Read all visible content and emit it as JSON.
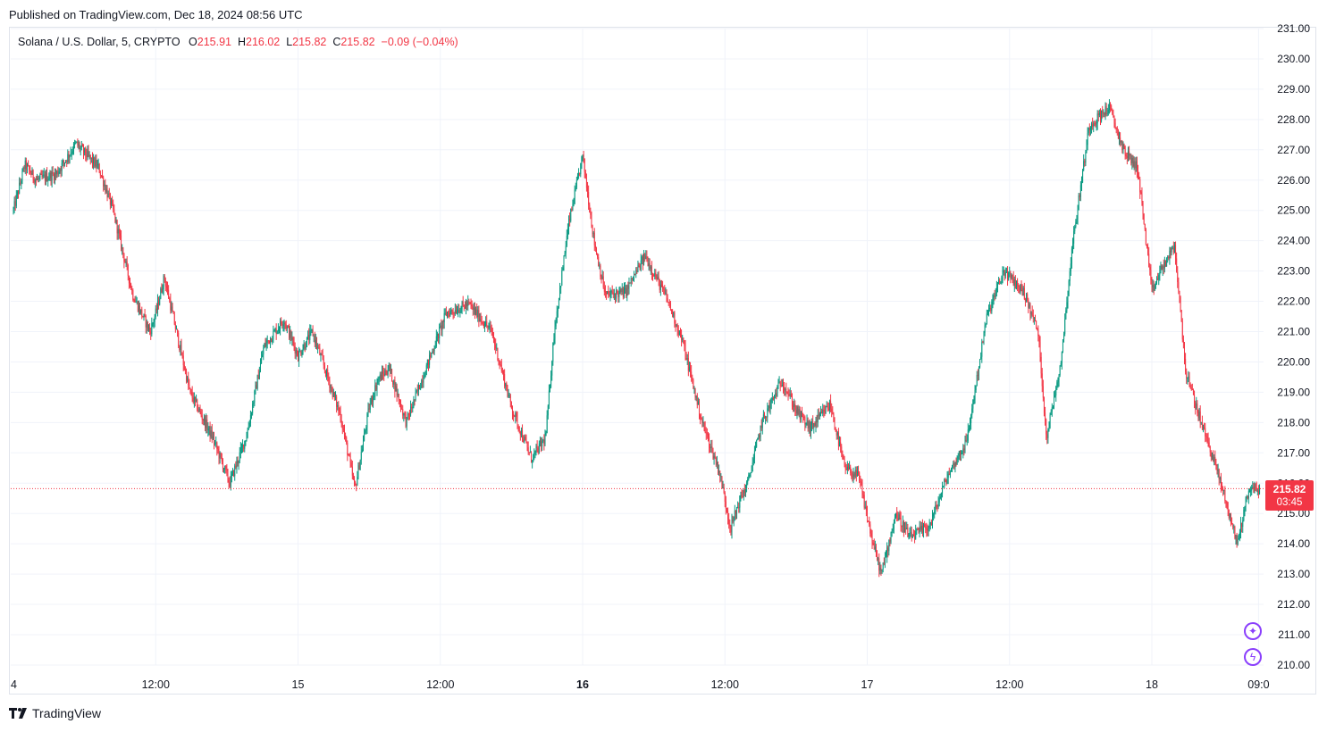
{
  "header": {
    "published": "Published on TradingView.com, Dec 18, 2024 08:56 UTC"
  },
  "legend": {
    "symbol": "Solana / U.S. Dollar, 5, CRYPTO",
    "o_label": "O",
    "o_value": "215.91",
    "h_label": "H",
    "h_value": "216.02",
    "l_label": "L",
    "l_value": "215.82",
    "c_label": "C",
    "c_value": "215.82",
    "change": "−0.09 (−0.04%)"
  },
  "price_tag": {
    "price": "215.82",
    "countdown": "03:45"
  },
  "footer": {
    "brand": "TradingView"
  },
  "colors": {
    "up": "#089981",
    "down": "#f23645",
    "wick": "#131722",
    "grid": "#f0f3fa",
    "current_line": "#f23645",
    "accent_purple": "#8a3ffc"
  },
  "icons": {
    "sparkle": "sparkle-icon",
    "lightning": "lightning-icon"
  },
  "chart_data": {
    "type": "candlestick",
    "symbol": "Solana / U.S. Dollar",
    "interval": "5",
    "ylim": [
      210,
      231
    ],
    "yticks": [
      "210.00",
      "211.00",
      "212.00",
      "213.00",
      "214.00",
      "215.00",
      "216.00",
      "217.00",
      "218.00",
      "219.00",
      "220.00",
      "221.00",
      "222.00",
      "223.00",
      "224.00",
      "225.00",
      "226.00",
      "227.00",
      "228.00",
      "229.00",
      "230.00",
      "231.00"
    ],
    "xticks": [
      {
        "label": "4",
        "t": 0,
        "bold": false
      },
      {
        "label": "12:00",
        "t": 0.5,
        "bold": false
      },
      {
        "label": "15",
        "t": 1.0,
        "bold": false
      },
      {
        "label": "12:00",
        "t": 1.5,
        "bold": false
      },
      {
        "label": "16",
        "t": 2.0,
        "bold": true
      },
      {
        "label": "12:00",
        "t": 2.5,
        "bold": false
      },
      {
        "label": "17",
        "t": 3.0,
        "bold": false
      },
      {
        "label": "12:00",
        "t": 3.5,
        "bold": false
      },
      {
        "label": "18",
        "t": 4.0,
        "bold": false
      },
      {
        "label": "09:0",
        "t": 4.375,
        "bold": false
      }
    ],
    "current_price": 215.82,
    "grid": true,
    "price_path_days": [
      0,
      0.04,
      0.08,
      0.15,
      0.22,
      0.3,
      0.35,
      0.42,
      0.48,
      0.5,
      0.53,
      0.62,
      0.7,
      0.76,
      0.82,
      0.88,
      0.95,
      1.0,
      1.05,
      1.15,
      1.2,
      1.25,
      1.28,
      1.32,
      1.38,
      1.45,
      1.52,
      1.6,
      1.68,
      1.75,
      1.82,
      1.87,
      1.9,
      1.95,
      2.0,
      2.04,
      2.08,
      2.15,
      2.22,
      2.3,
      2.35,
      2.42,
      2.48,
      2.52,
      2.55,
      2.58,
      2.63,
      2.7,
      2.75,
      2.8,
      2.87,
      2.92,
      2.97,
      3.02,
      3.05,
      3.1,
      3.15,
      3.22,
      3.28,
      3.35,
      3.42,
      3.48,
      3.55,
      3.6,
      3.63,
      3.68,
      3.72,
      3.78,
      3.85,
      3.9,
      3.95,
      4.0,
      4.03,
      4.08,
      4.12,
      4.18,
      4.22,
      4.26,
      4.3,
      4.34,
      4.38
    ],
    "price_path": [
      225.0,
      226.5,
      226.0,
      226.2,
      227.2,
      226.4,
      225.0,
      222.2,
      221.0,
      221.6,
      222.8,
      219.0,
      217.5,
      216.0,
      217.6,
      220.5,
      221.4,
      220.2,
      221.0,
      218.2,
      215.8,
      218.5,
      219.4,
      219.8,
      218.0,
      219.8,
      221.6,
      221.9,
      221.0,
      218.5,
      216.8,
      217.5,
      221.0,
      224.5,
      226.8,
      224.0,
      222.2,
      222.3,
      223.5,
      222.0,
      220.7,
      218.0,
      216.4,
      214.5,
      215.4,
      216.0,
      218.0,
      219.4,
      218.4,
      217.8,
      218.6,
      216.5,
      216.2,
      214.0,
      213.0,
      215.0,
      214.2,
      214.6,
      216.2,
      217.4,
      221.5,
      223.0,
      222.3,
      221.0,
      217.5,
      220.0,
      223.8,
      227.8,
      228.4,
      227.0,
      226.4,
      222.3,
      223.0,
      223.8,
      219.6,
      217.8,
      216.7,
      215.4,
      214.0,
      215.8,
      215.82
    ]
  }
}
